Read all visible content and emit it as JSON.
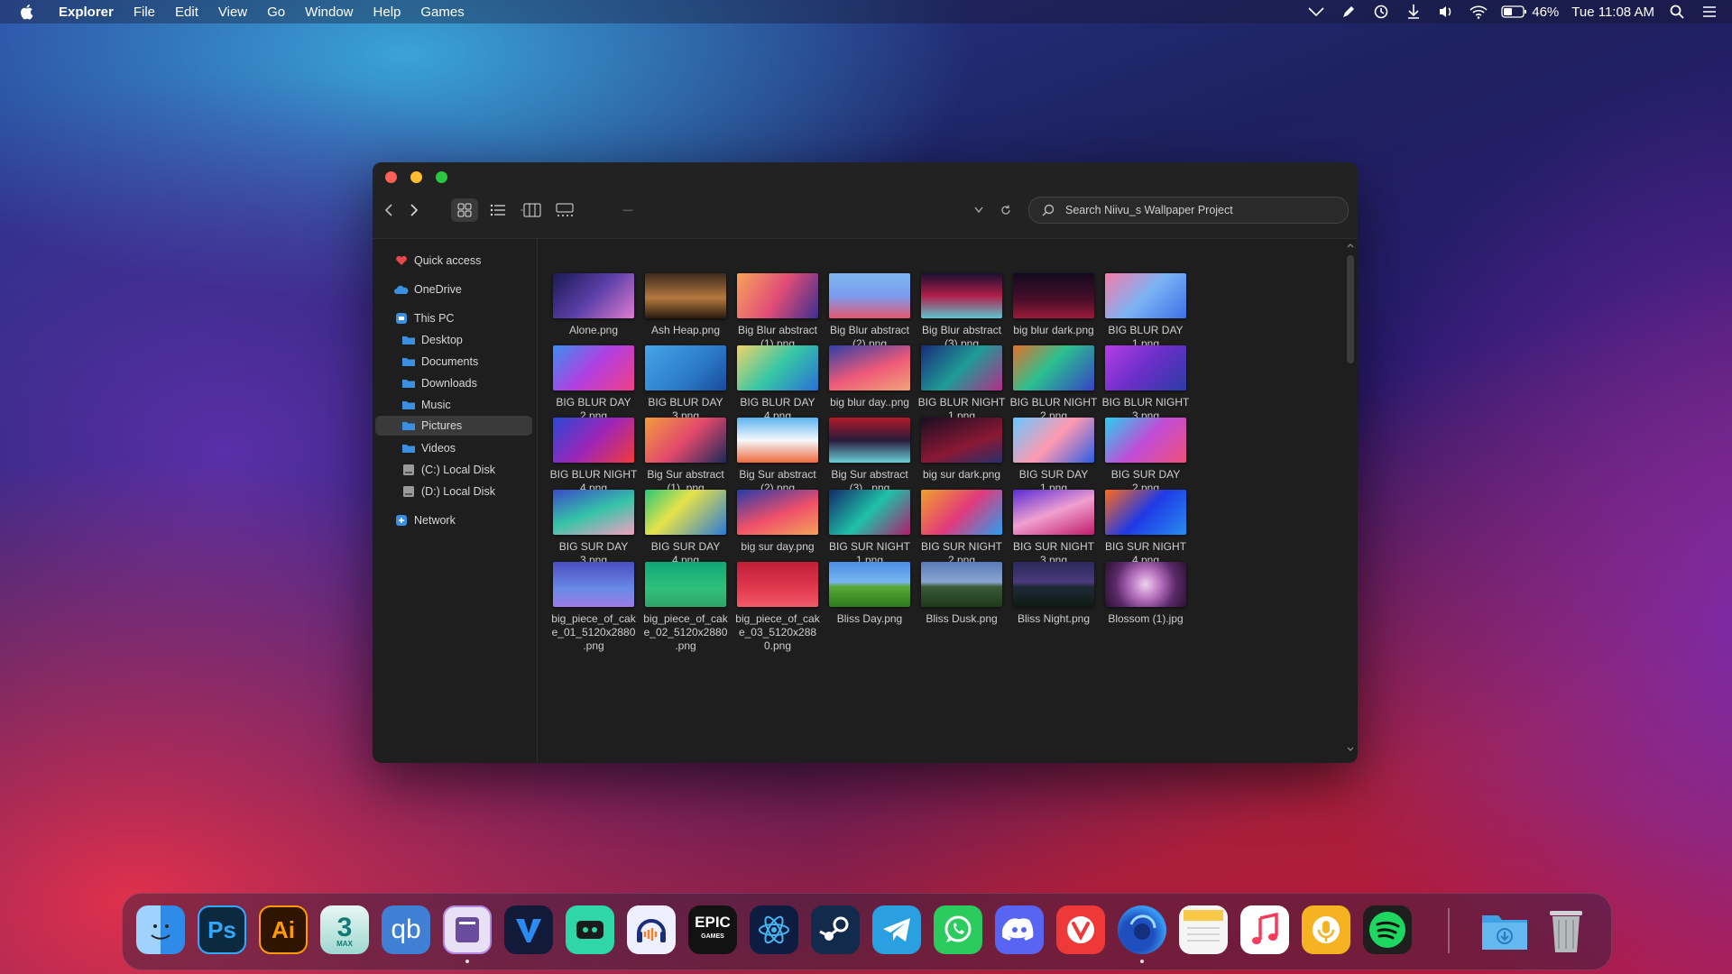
{
  "menubar": {
    "apple_icon": "apple-logo-icon",
    "app_name": "Explorer",
    "menus": [
      "File",
      "Edit",
      "View",
      "Go",
      "Window",
      "Help",
      "Games"
    ],
    "battery": "46%",
    "clock": "Tue 11:08 AM"
  },
  "window": {
    "search_placeholder": "Search Niivu_s Wallpaper Project",
    "breadcrumb": "—"
  },
  "sidebar": {
    "quick_access": "Quick access",
    "onedrive": "OneDrive",
    "this_pc": "This PC",
    "items": [
      "Desktop",
      "Documents",
      "Downloads",
      "Music",
      "Pictures",
      "Videos",
      "(C:) Local Disk",
      "(D:) Local Disk"
    ],
    "network": "Network",
    "selected": "Pictures"
  },
  "files": [
    {
      "l1": "Alone.png",
      "l2": "",
      "l3": ""
    },
    {
      "l1": "Ash Heap.png",
      "l2": "",
      "l3": ""
    },
    {
      "l1": "Big Blur abstract",
      "l2": "(1).png",
      "l3": ""
    },
    {
      "l1": "Big Blur abstract",
      "l2": "(2).png",
      "l3": ""
    },
    {
      "l1": "Big Blur abstract",
      "l2": "(3).png",
      "l3": ""
    },
    {
      "l1": "big blur dark.png",
      "l2": "",
      "l3": ""
    },
    {
      "l1": "BIG BLUR DAY",
      "l2": "1.png",
      "l3": ""
    },
    {
      "l1": "BIG BLUR DAY",
      "l2": "2.png",
      "l3": ""
    },
    {
      "l1": "BIG BLUR DAY",
      "l2": "3.png",
      "l3": ""
    },
    {
      "l1": "BIG BLUR DAY",
      "l2": "4.png",
      "l3": ""
    },
    {
      "l1": "big blur day..png",
      "l2": "",
      "l3": ""
    },
    {
      "l1": "BIG BLUR NIGHT",
      "l2": "1.png",
      "l3": ""
    },
    {
      "l1": "BIG BLUR NIGHT",
      "l2": "2.png",
      "l3": ""
    },
    {
      "l1": "BIG BLUR NIGHT",
      "l2": "3.png",
      "l3": ""
    },
    {
      "l1": "BIG BLUR NIGHT",
      "l2": "4.png",
      "l3": ""
    },
    {
      "l1": "Big Sur abstract",
      "l2": "(1) .png",
      "l3": ""
    },
    {
      "l1": "Big Sur abstract",
      "l2": "(2).png",
      "l3": ""
    },
    {
      "l1": "Big Sur abstract",
      "l2": "(3) ..png",
      "l3": ""
    },
    {
      "l1": "big sur dark.png",
      "l2": "",
      "l3": ""
    },
    {
      "l1": "BIG SUR DAY",
      "l2": "1.png",
      "l3": ""
    },
    {
      "l1": "BIG SUR DAY",
      "l2": "2.png",
      "l3": ""
    },
    {
      "l1": "BIG SUR DAY",
      "l2": "3.png",
      "l3": ""
    },
    {
      "l1": "BIG SUR DAY",
      "l2": "4.png",
      "l3": ""
    },
    {
      "l1": "big sur day.png",
      "l2": "",
      "l3": ""
    },
    {
      "l1": "BIG SUR NIGHT",
      "l2": "1.png",
      "l3": ""
    },
    {
      "l1": "BIG SUR NIGHT",
      "l2": "2.png",
      "l3": ""
    },
    {
      "l1": "BIG SUR NIGHT",
      "l2": "3.png",
      "l3": ""
    },
    {
      "l1": "BIG SUR NIGHT",
      "l2": "4.png",
      "l3": ""
    },
    {
      "l1": "big_piece_of_cak",
      "l2": "e_01_5120x2880",
      "l3": ".png"
    },
    {
      "l1": "big_piece_of_cak",
      "l2": "e_02_5120x2880",
      "l3": ".png"
    },
    {
      "l1": "big_piece_of_cak",
      "l2": "e_03_5120x288",
      "l3": "0.png"
    },
    {
      "l1": "Bliss Day.png",
      "l2": "",
      "l3": ""
    },
    {
      "l1": "Bliss Dusk.png",
      "l2": "",
      "l3": ""
    },
    {
      "l1": "Bliss Night.png",
      "l2": "",
      "l3": ""
    },
    {
      "l1": "Blossom (1).jpg",
      "l2": "",
      "l3": ""
    }
  ],
  "dock": {
    "apps": [
      "finder-icon",
      "photoshop-icon",
      "illustrator-icon",
      "3ds-max-icon",
      "qbittorrent-icon",
      "explorer-files-icon",
      "vivaldi-v-icon",
      "streamlabs-icon",
      "audacity-icon",
      "epic-games-icon",
      "electron-icon",
      "steam-icon",
      "telegram-icon",
      "whatsapp-icon",
      "discord-icon",
      "vivaldi-icon",
      "firefox-icon",
      "notes-icon",
      "music-icon",
      "podcast-icon",
      "spotify-icon",
      "downloads-folder-icon",
      "trash-icon"
    ],
    "labels": {
      "ps": "Ps",
      "ai": "Ai",
      "max": "3",
      "max_sub": "MAX",
      "qb": "qb",
      "epic1": "EPIC",
      "epic2": "GAMES"
    }
  }
}
